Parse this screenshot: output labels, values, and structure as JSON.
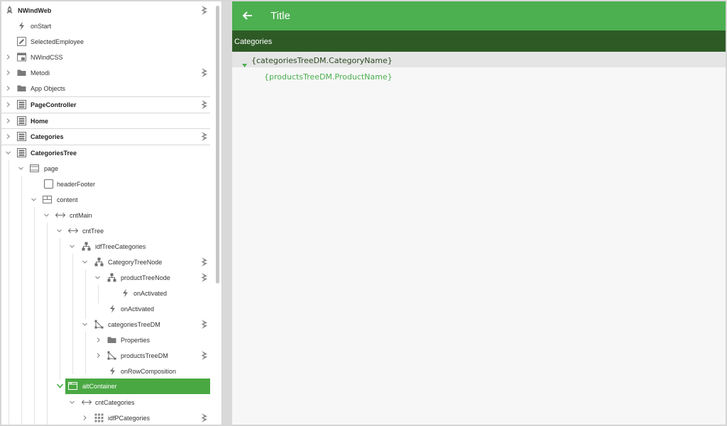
{
  "tree": {
    "items": [
      {
        "label": "NWindWeb",
        "icon": "rocket-icon"
      },
      {
        "label": "onStart",
        "icon": "lightning-icon"
      },
      {
        "label": "SelectedEmployee",
        "icon": "pencil-icon"
      },
      {
        "label": "NWindCSS",
        "icon": "stylesheet-icon"
      },
      {
        "label": "Metodi",
        "icon": "folder-icon"
      },
      {
        "label": "App Objects",
        "icon": "folder-icon"
      },
      {
        "label": "PageController",
        "icon": "form-icon"
      },
      {
        "label": "Home",
        "icon": "form-icon"
      },
      {
        "label": "Categories",
        "icon": "form-icon"
      },
      {
        "label": "CategoriesTree",
        "icon": "form-icon"
      },
      {
        "label": "page",
        "icon": "page-layout-icon"
      },
      {
        "label": "headerFooter",
        "icon": "checkbox-square-icon"
      },
      {
        "label": "content",
        "icon": "grid-layout-icon"
      },
      {
        "label": "cntMain",
        "icon": "container-icon"
      },
      {
        "label": "cntTree",
        "icon": "container-icon"
      },
      {
        "label": "idfTreeCategories",
        "icon": "hierarchy-icon"
      },
      {
        "label": "CategoryTreeNode",
        "icon": "hierarchy-icon"
      },
      {
        "label": "productTreeNode",
        "icon": "hierarchy-icon"
      },
      {
        "label": "onActivated",
        "icon": "lightning-icon"
      },
      {
        "label": "onActivated",
        "icon": "lightning-icon"
      },
      {
        "label": "categoriesTreeDM",
        "icon": "datamap-icon"
      },
      {
        "label": "Properties",
        "icon": "folder-icon"
      },
      {
        "label": "productsTreeDM",
        "icon": "datamap-icon"
      },
      {
        "label": "onRowComposition",
        "icon": "lightning-icon"
      },
      {
        "label": "altContainer",
        "icon": "window-icon"
      },
      {
        "label": "cntCategories",
        "icon": "container-icon"
      },
      {
        "label": "idfPCategories",
        "icon": "dotgrid-icon"
      }
    ]
  },
  "preview": {
    "title": "Title",
    "section": "Categories",
    "category_row": "{categoriesTreeDM.CategoryName}",
    "product_row": "{productsTreeDM.ProductName}"
  },
  "colors": {
    "accent": "#4caf50",
    "accent_dark": "#2e5a26",
    "selection": "#4aa843"
  }
}
